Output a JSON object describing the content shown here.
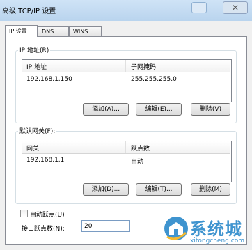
{
  "window": {
    "title": "高级 TCP/IP 设置",
    "close_glyph": "✕"
  },
  "tabs": [
    {
      "label": "IP 设置",
      "active": true
    },
    {
      "label": "DNS",
      "active": false
    },
    {
      "label": "WINS",
      "active": false
    }
  ],
  "ip_group": {
    "label": "IP 地址(R)",
    "columns": [
      "IP 地址",
      "子网掩码"
    ],
    "rows": [
      {
        "ip": "192.168.1.150",
        "mask": "255.255.255.0"
      }
    ],
    "buttons": {
      "add": "添加(A)...",
      "edit": "编辑(E)...",
      "delete": "删除(V)"
    }
  },
  "gateway_group": {
    "label": "默认网关(F):",
    "columns": [
      "网关",
      "跃点数"
    ],
    "rows": [
      {
        "gateway": "192.168.1.1",
        "metric": "自动"
      }
    ],
    "buttons": {
      "add": "添加(D)...",
      "edit": "编辑(T)...",
      "delete": "删除(M)"
    }
  },
  "auto_metric": {
    "label": "自动跃点(U)",
    "checked": false
  },
  "interface_metric": {
    "label": "接口跃点数(N):",
    "value": "20"
  },
  "watermark": {
    "brand": "系统城",
    "url": "xitongcheng.com",
    "color": "#3f94cf"
  }
}
